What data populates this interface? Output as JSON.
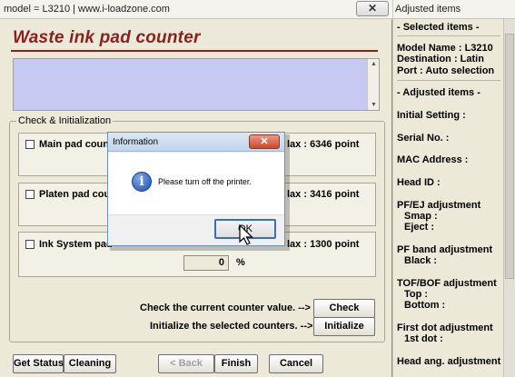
{
  "main_window": {
    "title": "model = L3210 | www.i-loadzone.com",
    "close_glyph": "✕",
    "heading": "Waste ink pad counter"
  },
  "check_init": {
    "group_title": "Check & Initialization",
    "panels": [
      {
        "label": "Main pad count",
        "max_label": "lax : 6346 point"
      },
      {
        "label": "Platen pad cou",
        "max_label": "lax : 3416 point"
      },
      {
        "label": "Ink System pad",
        "max_label": "lax : 1300 point"
      }
    ],
    "counter_value": "0",
    "percent_sign": "%",
    "check_row_label": "Check the current counter value. -->",
    "init_row_label": "Initialize the selected counters. -->",
    "check_button": "Check",
    "initialize_button": "Initialize"
  },
  "bottom_buttons": {
    "get_status": "Get Status",
    "cleaning": "Cleaning",
    "back": "< Back",
    "finish": "Finish",
    "cancel": "Cancel"
  },
  "dialog": {
    "title": "Information",
    "close_glyph": "✕",
    "icon_glyph": "i",
    "message": "Please turn off the printer.",
    "ok_label": "OK"
  },
  "adjusted_pane": {
    "title": "Adjusted items",
    "selected_header": "- Selected items -",
    "model_name": "Model Name : L3210",
    "destination": "Destination : Latin",
    "port": "Port : Auto selection",
    "adjusted_header": "- Adjusted items -",
    "items": [
      "Initial Setting :",
      "Serial No. :",
      "MAC Address :",
      "Head ID :",
      "PF/EJ adjustment",
      "Smap :",
      "Eject :",
      "PF band adjustment",
      "Black :",
      "TOF/BOF adjustment",
      "Top :",
      "Bottom :",
      "First dot adjustment",
      "1st dot :",
      "Head ang. adjustment"
    ]
  },
  "colors": {
    "heading": "#8b2020",
    "info_box": "#c6c9f2",
    "window_bg": "#ece9d8"
  }
}
